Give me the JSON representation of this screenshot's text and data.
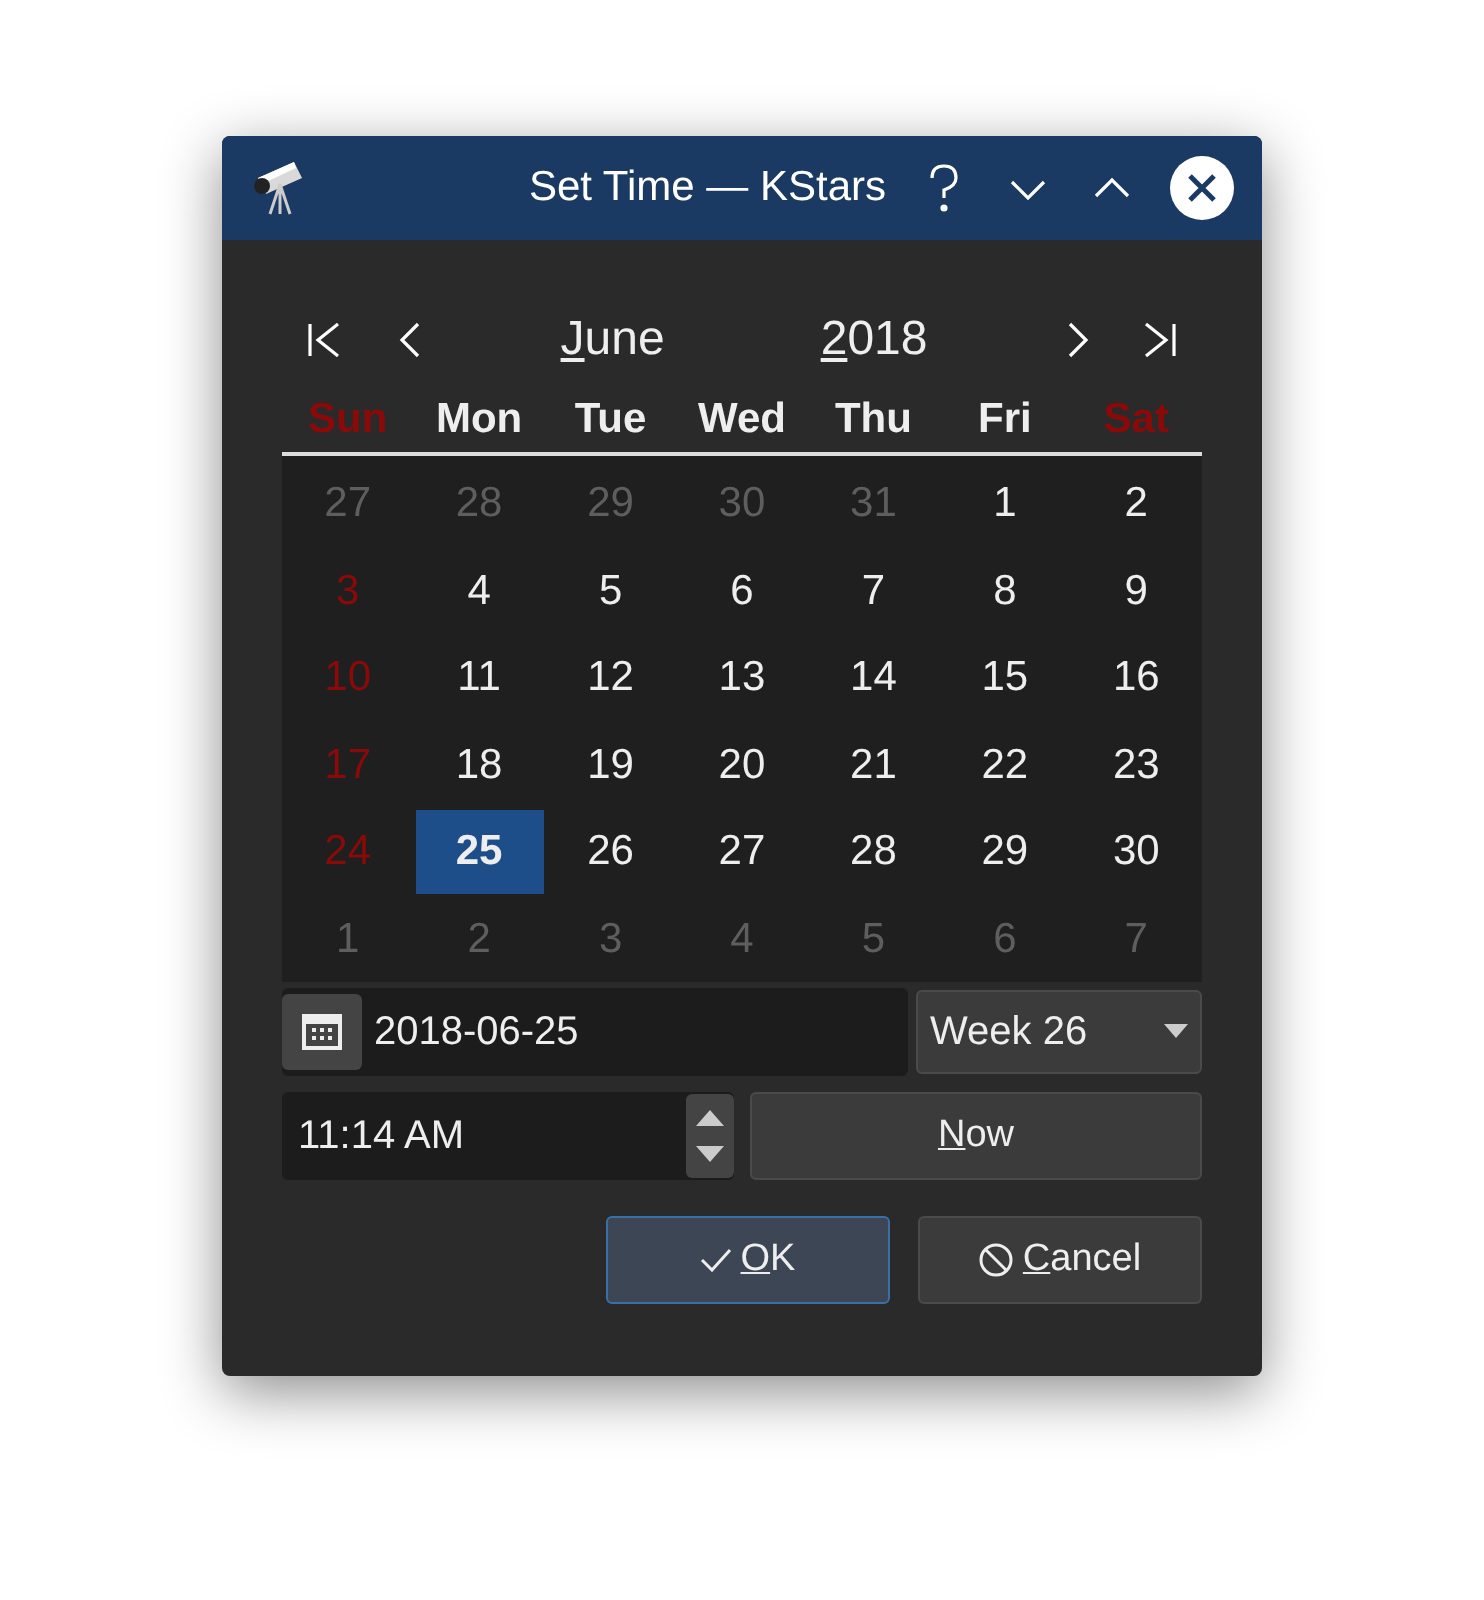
{
  "window": {
    "title": "Set Time — KStars"
  },
  "navigation": {
    "month": {
      "label": "June",
      "mnemonic": true
    },
    "year": {
      "label": "2018",
      "mnemonic": true
    }
  },
  "weekdays": [
    {
      "label": "Sun",
      "weekend": true
    },
    {
      "label": "Mon",
      "weekend": false
    },
    {
      "label": "Tue",
      "weekend": false
    },
    {
      "label": "Wed",
      "weekend": false
    },
    {
      "label": "Thu",
      "weekend": false
    },
    {
      "label": "Fri",
      "weekend": false
    },
    {
      "label": "Sat",
      "weekend": true
    }
  ],
  "weeks": [
    [
      {
        "day": "27",
        "in_month": false,
        "holiday": false,
        "selected": false
      },
      {
        "day": "28",
        "in_month": false,
        "holiday": false,
        "selected": false
      },
      {
        "day": "29",
        "in_month": false,
        "holiday": false,
        "selected": false
      },
      {
        "day": "30",
        "in_month": false,
        "holiday": false,
        "selected": false
      },
      {
        "day": "31",
        "in_month": false,
        "holiday": false,
        "selected": false
      },
      {
        "day": "1",
        "in_month": true,
        "holiday": false,
        "selected": false
      },
      {
        "day": "2",
        "in_month": true,
        "holiday": false,
        "selected": false
      }
    ],
    [
      {
        "day": "3",
        "in_month": true,
        "holiday": true,
        "selected": false
      },
      {
        "day": "4",
        "in_month": true,
        "holiday": false,
        "selected": false
      },
      {
        "day": "5",
        "in_month": true,
        "holiday": false,
        "selected": false
      },
      {
        "day": "6",
        "in_month": true,
        "holiday": false,
        "selected": false
      },
      {
        "day": "7",
        "in_month": true,
        "holiday": false,
        "selected": false
      },
      {
        "day": "8",
        "in_month": true,
        "holiday": false,
        "selected": false
      },
      {
        "day": "9",
        "in_month": true,
        "holiday": false,
        "selected": false
      }
    ],
    [
      {
        "day": "10",
        "in_month": true,
        "holiday": true,
        "selected": false
      },
      {
        "day": "11",
        "in_month": true,
        "holiday": false,
        "selected": false
      },
      {
        "day": "12",
        "in_month": true,
        "holiday": false,
        "selected": false
      },
      {
        "day": "13",
        "in_month": true,
        "holiday": false,
        "selected": false
      },
      {
        "day": "14",
        "in_month": true,
        "holiday": false,
        "selected": false
      },
      {
        "day": "15",
        "in_month": true,
        "holiday": false,
        "selected": false
      },
      {
        "day": "16",
        "in_month": true,
        "holiday": false,
        "selected": false
      }
    ],
    [
      {
        "day": "17",
        "in_month": true,
        "holiday": true,
        "selected": false
      },
      {
        "day": "18",
        "in_month": true,
        "holiday": false,
        "selected": false
      },
      {
        "day": "19",
        "in_month": true,
        "holiday": false,
        "selected": false
      },
      {
        "day": "20",
        "in_month": true,
        "holiday": false,
        "selected": false
      },
      {
        "day": "21",
        "in_month": true,
        "holiday": false,
        "selected": false
      },
      {
        "day": "22",
        "in_month": true,
        "holiday": false,
        "selected": false
      },
      {
        "day": "23",
        "in_month": true,
        "holiday": false,
        "selected": false
      }
    ],
    [
      {
        "day": "24",
        "in_month": true,
        "holiday": true,
        "selected": false
      },
      {
        "day": "25",
        "in_month": true,
        "holiday": false,
        "selected": true
      },
      {
        "day": "26",
        "in_month": true,
        "holiday": false,
        "selected": false
      },
      {
        "day": "27",
        "in_month": true,
        "holiday": false,
        "selected": false
      },
      {
        "day": "28",
        "in_month": true,
        "holiday": false,
        "selected": false
      },
      {
        "day": "29",
        "in_month": true,
        "holiday": false,
        "selected": false
      },
      {
        "day": "30",
        "in_month": true,
        "holiday": false,
        "selected": false
      }
    ],
    [
      {
        "day": "1",
        "in_month": false,
        "holiday": false,
        "selected": false
      },
      {
        "day": "2",
        "in_month": false,
        "holiday": false,
        "selected": false
      },
      {
        "day": "3",
        "in_month": false,
        "holiday": false,
        "selected": false
      },
      {
        "day": "4",
        "in_month": false,
        "holiday": false,
        "selected": false
      },
      {
        "day": "5",
        "in_month": false,
        "holiday": false,
        "selected": false
      },
      {
        "day": "6",
        "in_month": false,
        "holiday": false,
        "selected": false
      },
      {
        "day": "7",
        "in_month": false,
        "holiday": false,
        "selected": false
      }
    ]
  ],
  "date_field": {
    "value": "2018-06-25"
  },
  "week_select": {
    "value": "Week 26"
  },
  "time_field": {
    "value": "11:14 AM"
  },
  "buttons": [
    {
      "kind": "now",
      "label": "Now",
      "mnemonic": true,
      "default": false
    },
    {
      "kind": "ok",
      "label": "OK",
      "mnemonic": true,
      "default": true
    },
    {
      "kind": "cancel",
      "label": "Cancel",
      "mnemonic": true,
      "default": false
    }
  ]
}
